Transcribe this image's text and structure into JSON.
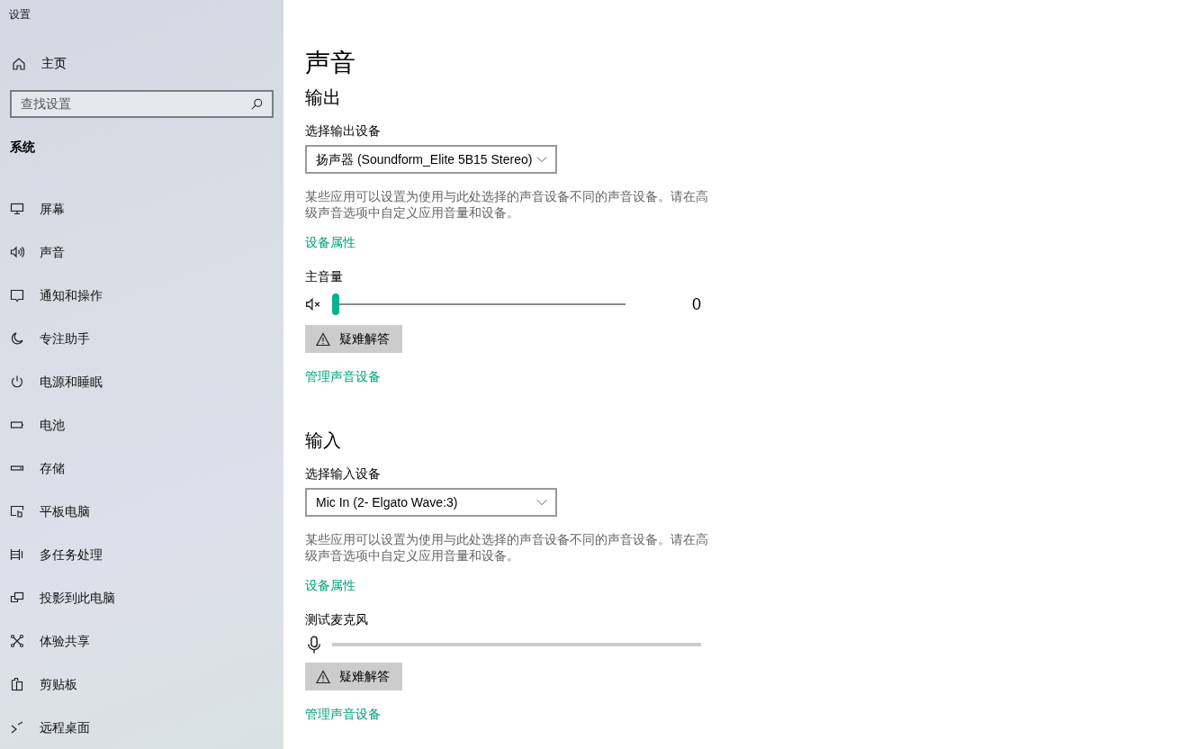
{
  "window": {
    "title": "设置"
  },
  "sidebar": {
    "home": "主页",
    "search": {
      "placeholder": "查找设置"
    },
    "section": "系统",
    "items": [
      {
        "label": "屏幕"
      },
      {
        "label": "声音"
      },
      {
        "label": "通知和操作"
      },
      {
        "label": "专注助手"
      },
      {
        "label": "电源和睡眠"
      },
      {
        "label": "电池"
      },
      {
        "label": "存储"
      },
      {
        "label": "平板电脑"
      },
      {
        "label": "多任务处理"
      },
      {
        "label": "投影到此电脑"
      },
      {
        "label": "体验共享"
      },
      {
        "label": "剪贴板"
      },
      {
        "label": "远程桌面"
      }
    ]
  },
  "page": {
    "title": "声音",
    "output": {
      "heading": "输出",
      "device_label": "选择输出设备",
      "device": "扬声器 (Soundform_Elite 5B15 Stereo)",
      "description": "某些应用可以设置为使用与此处选择的声音设备不同的声音设备。请在高级声音选项中自定义应用音量和设备。",
      "properties_link": "设备属性",
      "volume_label": "主音量",
      "volume": {
        "level": 0,
        "reading": "0"
      },
      "troubleshoot": "疑难解答",
      "manage_link": "管理声音设备"
    },
    "input": {
      "heading": "输入",
      "device_label": "选择输入设备",
      "device": "Mic In (2- Elgato Wave:3)",
      "description": "某些应用可以设置为使用与此处选择的声音设备不同的声音设备。请在高级声音选项中自定义应用音量和设备。",
      "properties_link": "设备属性",
      "test_label": "测试麦克风",
      "meter": {
        "level": 0
      },
      "troubleshoot": "疑难解答",
      "manage_link": "管理声音设备"
    }
  }
}
